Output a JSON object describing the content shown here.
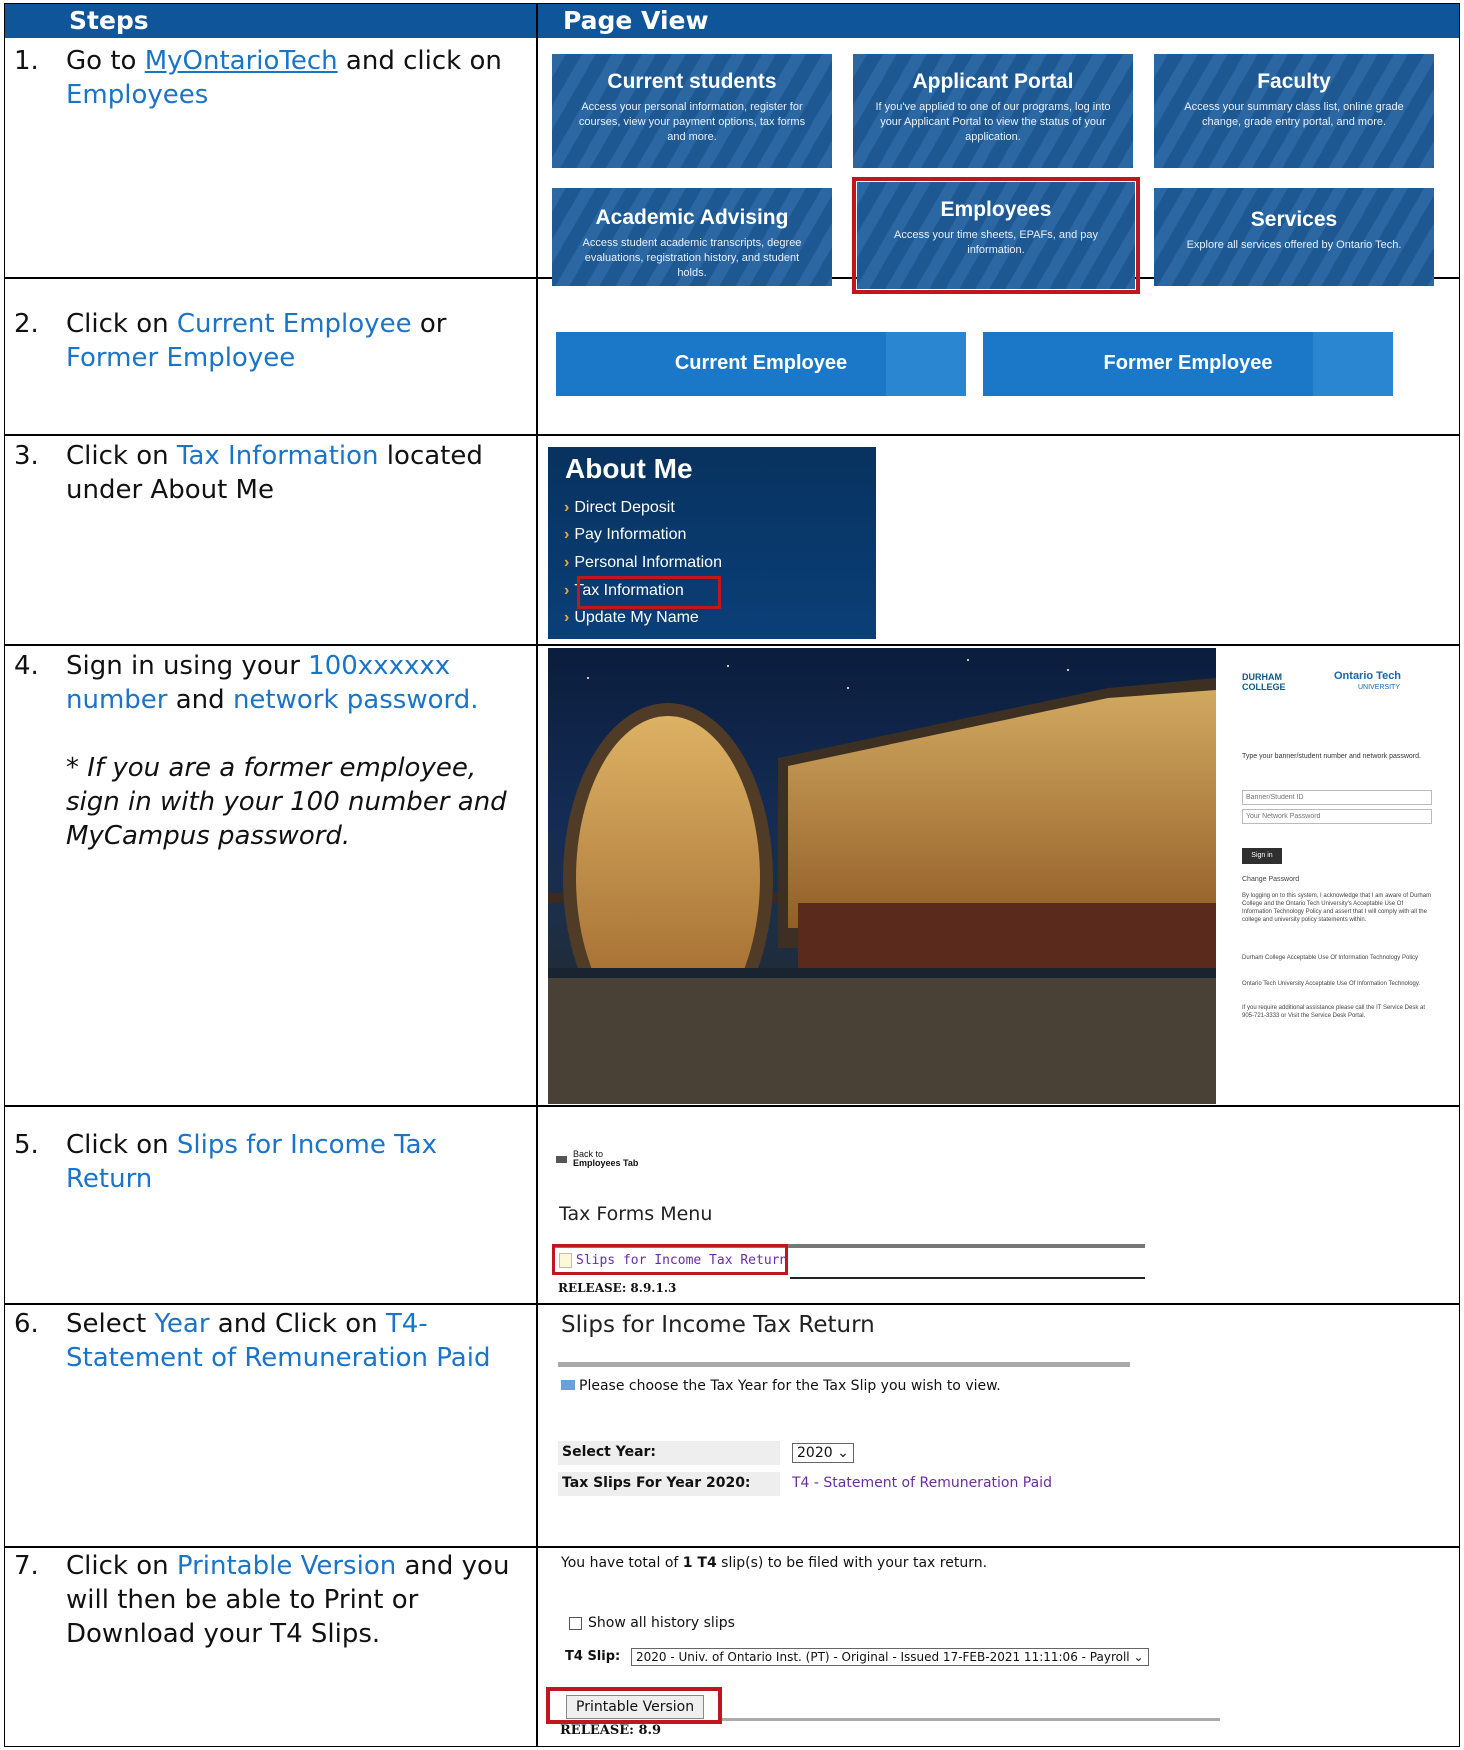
{
  "header": {
    "col1": "Steps",
    "col2": "Page View"
  },
  "steps": [
    {
      "num": "1.",
      "parts": [
        "Go to ",
        "MyOntarioTech",
        " and click on ",
        "Employees"
      ]
    },
    {
      "num": "2.",
      "parts": [
        "Click on ",
        "Current Employee",
        " or ",
        "Former Employee"
      ]
    },
    {
      "num": "3.",
      "parts": [
        "Click on ",
        "Tax Information",
        " located under About Me"
      ]
    },
    {
      "num": "4.",
      "parts": [
        "Sign in using your ",
        "100xxxxxx number",
        " and ",
        "network password."
      ],
      "note": "* If you are a former employee, sign in with your 100 number and MyCampus password."
    },
    {
      "num": "5.",
      "parts": [
        "Click on ",
        "Slips for Income Tax Return"
      ]
    },
    {
      "num": "6.",
      "parts": [
        "Select ",
        "Year",
        " and Click on ",
        "T4-Statement of Remuneration Paid"
      ]
    },
    {
      "num": "7.",
      "parts": [
        "Click on ",
        "Printable Version",
        " and you will then be able to Print or Download your T4 Slips."
      ]
    }
  ],
  "portal_tiles": [
    {
      "title": "Current students",
      "desc": "Access your personal information, register for courses, view your payment options, tax forms and more."
    },
    {
      "title": "Applicant Portal",
      "desc": "If you've applied to one of our programs, log into your Applicant Portal to view the status of your application."
    },
    {
      "title": "Faculty",
      "desc": "Access your summary class list, online grade change, grade entry portal, and more."
    },
    {
      "title": "Academic Advising",
      "desc": "Access student academic transcripts, degree evaluations, registration history, and student holds."
    },
    {
      "title": "Employees",
      "desc": "Access your time sheets, EPAFs, and pay information."
    },
    {
      "title": "Services",
      "desc": "Explore all services offered by Ontario Tech."
    }
  ],
  "employee_buttons": [
    "Current Employee",
    "Former Employee"
  ],
  "about_me": {
    "title": "About Me",
    "items": [
      "Direct Deposit",
      "Pay Information",
      "Personal Information",
      "Tax Information",
      "Update My Name"
    ]
  },
  "signin": {
    "logo1": "DURHAM COLLEGE",
    "logo2": "Ontario Tech",
    "logo2_sub": "UNIVERSITY",
    "prompt": "Type your banner/student number and network password.",
    "id_placeholder": "Banner/Student ID",
    "pw_placeholder": "Your Network Password",
    "button": "Sign in",
    "change_pw": "Change Password",
    "policy": "By logging on to this system, I acknowledge that I am aware of Durham College and the Ontario Tech University's Acceptable Use Of Information Technology Policy and assert that I will comply with all the college and university policy statements within.",
    "dc_policy": "Durham College Acceptable Use Of Information Technology Policy",
    "otu_policy": "Ontario Tech University Acceptable Use Of Information Technology.",
    "help": "If you require additional assistance please call the IT Service Desk at 905-721-3333 or Visit the Service Desk Portal."
  },
  "tax_menu": {
    "back": [
      "Back to",
      "Employees Tab"
    ],
    "title": "Tax Forms Menu",
    "link": "Slips for Income Tax Return",
    "release": "RELEASE: 8.9.1.3"
  },
  "slips": {
    "title": "Slips for Income Tax Return",
    "info": "Please choose the Tax Year for the Tax Slip you wish to view.",
    "year_label": "Select Year:",
    "year_value": "2020",
    "slips_label": "Tax Slips For Year 2020:",
    "slip_link": "T4 - Statement of Remuneration Paid"
  },
  "printable": {
    "summary_pre": "You have total of ",
    "summary_count": "1 T4",
    "summary_post": " slip(s) to be filed with your tax return.",
    "history": "Show all history slips",
    "t4_label": "T4 Slip:",
    "t4_value": "2020 - Univ. of Ontario Inst. (PT) - Original - Issued 17-FEB-2021 11:11:06 - Payroll",
    "button": "Printable Version",
    "release": "RELEASE: 8.9"
  }
}
